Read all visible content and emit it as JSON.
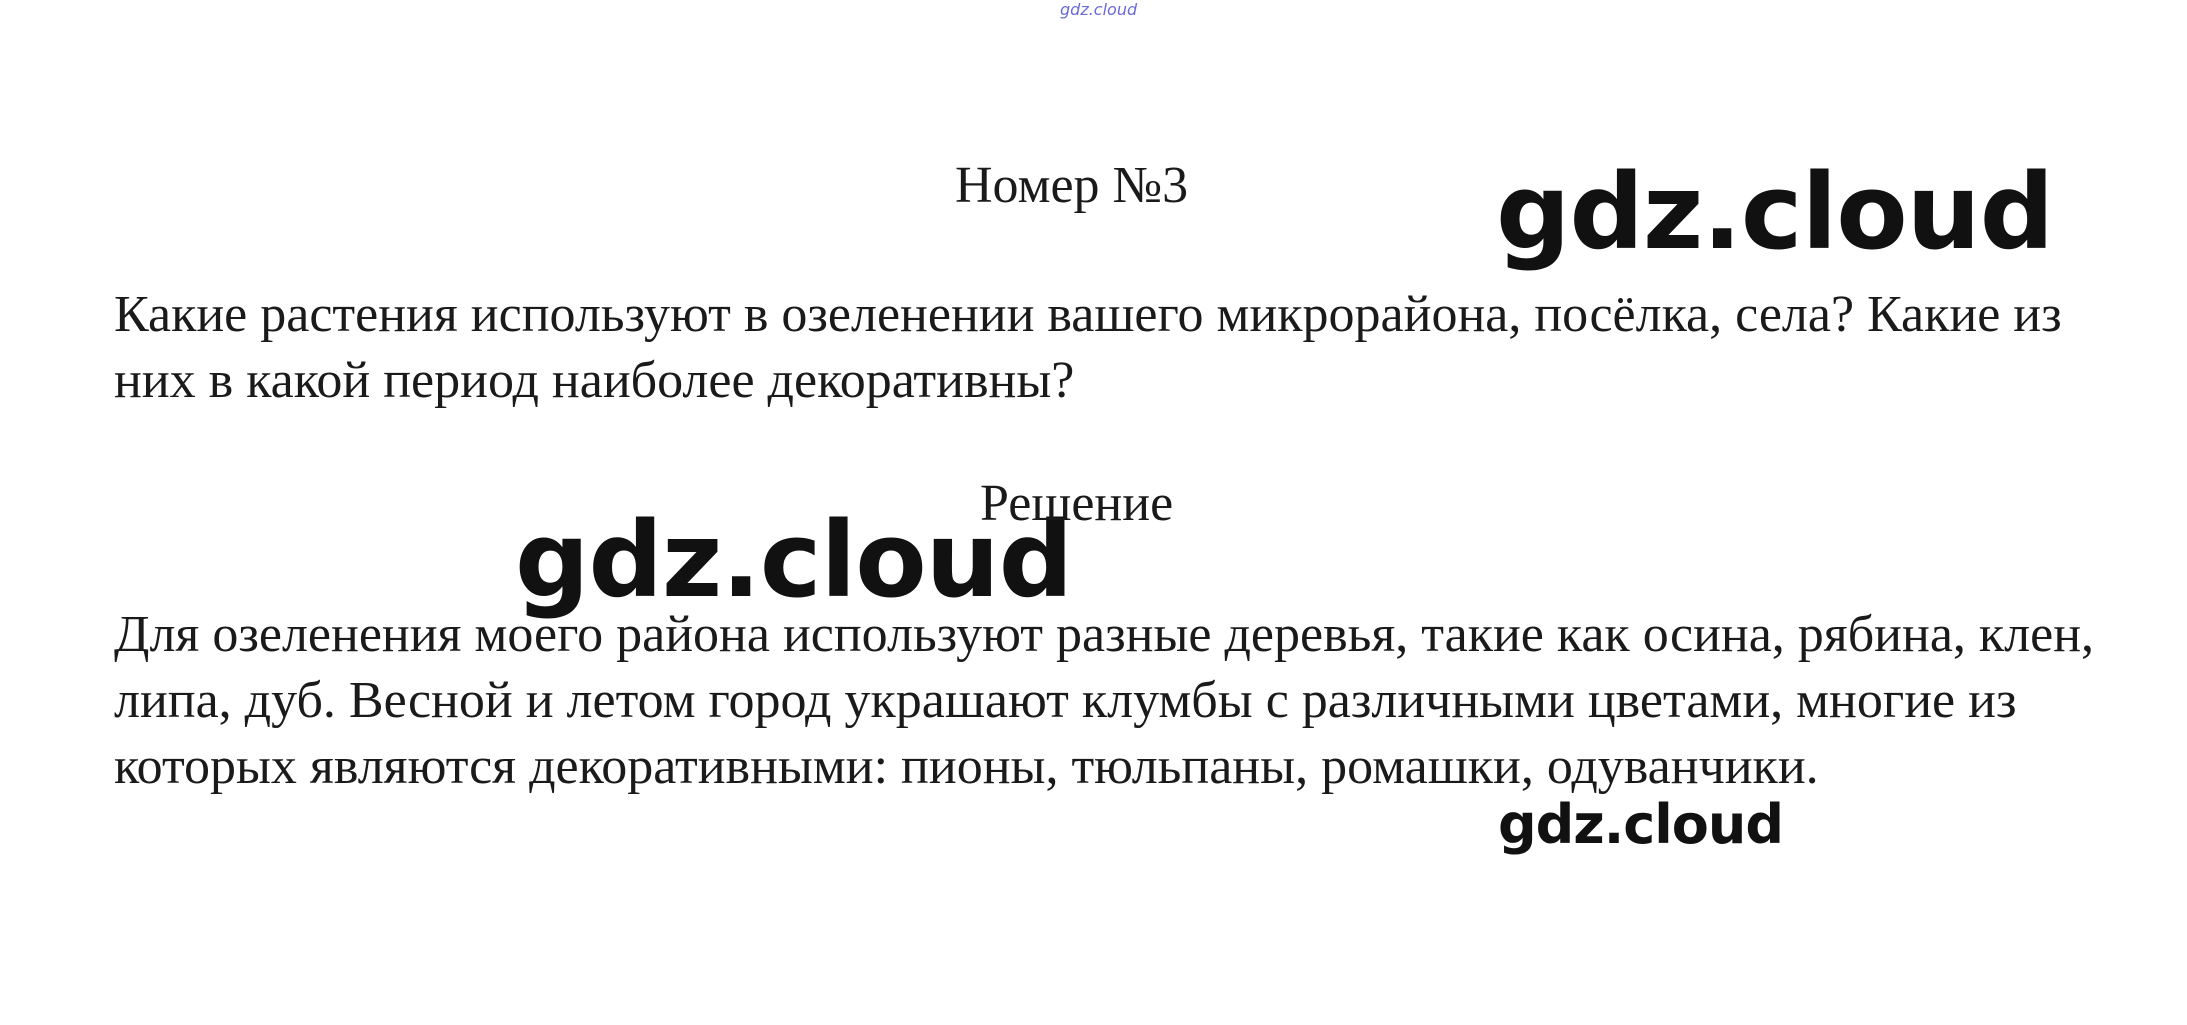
{
  "watermarks": {
    "tiny": "gdz.cloud",
    "large_top": "gdz.cloud",
    "large_mid": "gdz.cloud",
    "small": "gdz.cloud"
  },
  "task": {
    "heading": "Номер №3",
    "question": "Какие растения используют в озеленении вашего микрорайона, посёлка, села? Какие из них в какой период наиболее декоративны?"
  },
  "solution": {
    "title": "Решение",
    "answer": "Для озеленения моего района используют разные деревья, такие как осина, рябина, клен, липа, дуб. Весной и летом город украшают клумбы с различными цветами, многие из которых являются декоративными: пионы, тюльпаны, ромашки, одуванчики."
  }
}
